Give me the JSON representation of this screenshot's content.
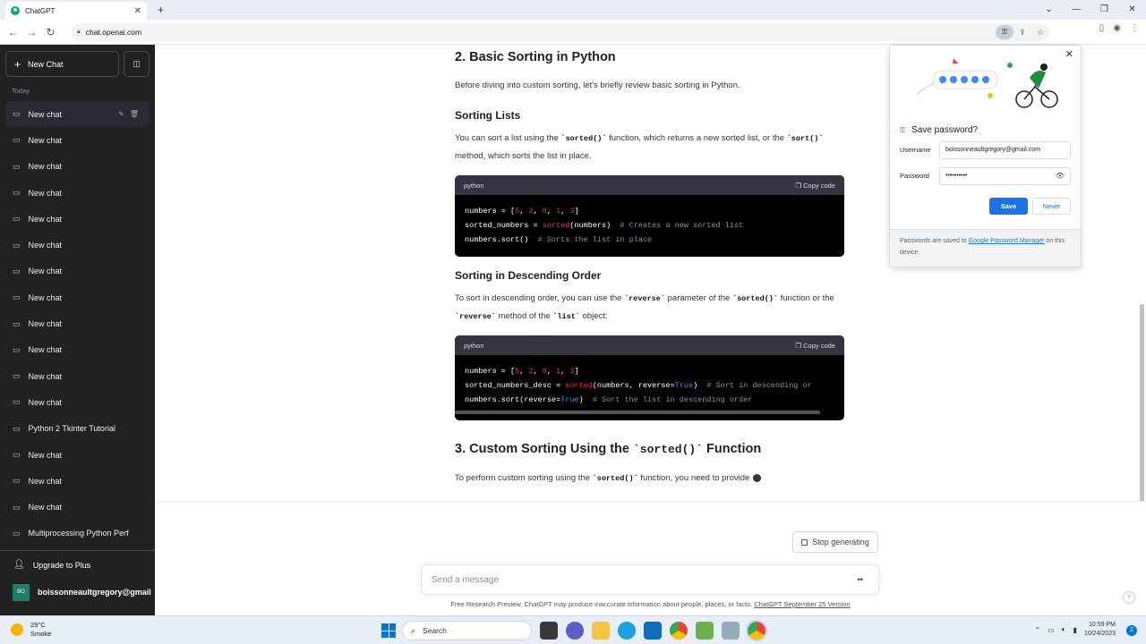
{
  "browser": {
    "tab_title": "ChatGPT",
    "url": "chat.openai.com",
    "win_min": "⌄",
    "min_label": "—",
    "max_label": "❐",
    "close_label": "✕"
  },
  "sidebar": {
    "new_chat_label": "New Chat",
    "section_label": "Today",
    "items": [
      {
        "label": "New chat"
      },
      {
        "label": "New chat"
      },
      {
        "label": "New chat"
      },
      {
        "label": "New chat"
      },
      {
        "label": "New chat"
      },
      {
        "label": "New chat"
      },
      {
        "label": "New chat"
      },
      {
        "label": "New chat"
      },
      {
        "label": "New chat"
      },
      {
        "label": "New chat"
      },
      {
        "label": "New chat"
      },
      {
        "label": "New chat"
      },
      {
        "label": "Python 2 Tkinter Tutorial"
      },
      {
        "label": "New chat"
      },
      {
        "label": "New chat"
      },
      {
        "label": "New chat"
      },
      {
        "label": "Multiprocessing Python Perf"
      }
    ],
    "upgrade_label": "Upgrade to Plus",
    "user_initials": "BO",
    "user_name": "boissonneaultgregory@gmail"
  },
  "content": {
    "h2_basic": "2. Basic Sorting in Python",
    "p_intro": "Before diving into custom sorting, let's briefly review basic sorting in Python.",
    "h3_lists": "Sorting Lists",
    "p_lists_1": "You can sort a list using the ",
    "p_lists_code1": "`sorted()`",
    "p_lists_2": " function, which returns a new sorted list, or the ",
    "p_lists_code2": "`sort()`",
    "p_lists_3": " method, which sorts the list in place.",
    "code1_lang": "python",
    "copy_label": "Copy code",
    "h3_desc": "Sorting in Descending Order",
    "p_desc_1": "To sort in descending order, you can use the ",
    "p_desc_code1": "`reverse`",
    "p_desc_2": " parameter of the ",
    "p_desc_code2": "`sorted()`",
    "p_desc_3": " function or the ",
    "p_desc_code3": "`reverse`",
    "p_desc_4": " method of the ",
    "p_desc_code4": "`list`",
    "p_desc_5": " object:",
    "code2_lang": "python",
    "h2_custom_1": "3. Custom Sorting Using the ",
    "h2_custom_code": "`sorted()`",
    "h2_custom_2": " Function",
    "p_custom_1": "To perform custom sorting using the ",
    "p_custom_code": "`sorted()`",
    "p_custom_2": " function, you need to provide"
  },
  "bottom": {
    "stop_label": "Stop generating",
    "placeholder": "Send a message",
    "disclaimer": "Free Research Preview. ChatGPT may produce inaccurate information about people, places, or facts.",
    "disclaimer_link": "ChatGPT September 25 Version",
    "help": "?"
  },
  "password_popup": {
    "title": "Save password?",
    "username_label": "Username",
    "username_value": "boissonneaultgregory@gmail.com",
    "password_label": "Password",
    "password_value": "••••••••••",
    "save_label": "Save",
    "never_label": "Never",
    "footer_1": "Passwords are saved to ",
    "footer_link": "Google Password Manager",
    "footer_2": " on this device."
  },
  "taskbar": {
    "temp": "29°C",
    "weather": "Smoke",
    "search_label": "Search",
    "time": "10:59 PM",
    "date": "10/24/2023",
    "notif_count": "2"
  },
  "colors": {
    "sidebar_bg": "#202123",
    "accent": "#10a37f",
    "chrome_blue": "#1a73e8"
  }
}
